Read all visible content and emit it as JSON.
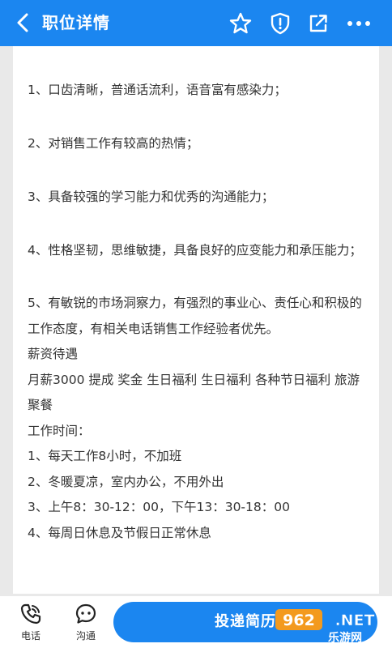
{
  "header": {
    "title": "职位详情"
  },
  "content": {
    "requirements": [
      "1、口齿清晰，普通话流利，语音富有感染力；",
      "2、对销售工作有较高的热情；",
      "3、具备较强的学习能力和优秀的沟通能力；",
      "4、性格坚韧，思维敏捷，具备良好的应变能力和承压能力；",
      "5、有敏锐的市场洞察力，有强烈的事业心、责任心和积极的工作态度，有相关电话销售工作经验者优先。"
    ],
    "salary_heading": "薪资待遇",
    "salary_details": "月薪3000 提成 奖金 生日福利 生日福利 各种节日福利 旅游 聚餐",
    "worktime_heading": "工作时间：",
    "worktime_items": [
      "1、每天工作8小时，不加班",
      "2、冬暖夏凉，室内办公，不用外出",
      "3、上午8：30-12：00，下午13：30-18：00",
      "4、每周日休息及节假日正常休息"
    ]
  },
  "bottom_bar": {
    "phone_label": "电话",
    "chat_label": "沟通",
    "apply_label": "投递简历"
  },
  "watermark": {
    "brand": "962.NET",
    "site": "乐游网"
  },
  "colors": {
    "primary": "#1b86f0",
    "watermark_orange": "#f39a1e"
  }
}
